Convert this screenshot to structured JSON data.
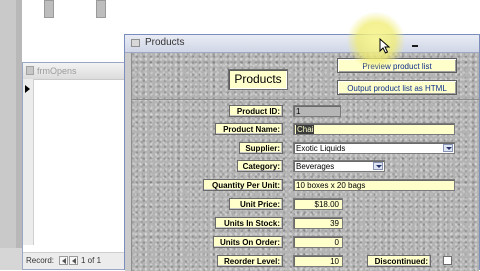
{
  "back_form": {
    "title": "frmOpens",
    "nav_label": "Record:",
    "nav_count": "1 of 1"
  },
  "window": {
    "title": "Products"
  },
  "form": {
    "header_title": "Products",
    "preview_button": "Preview product list",
    "output_button": "Output product list as HTML",
    "fields": {
      "product_id": {
        "label": "Product ID:",
        "value": "1"
      },
      "product_name": {
        "label": "Product Name:",
        "value": "Chai"
      },
      "supplier": {
        "label": "Supplier:",
        "value": "Exotic Liquids"
      },
      "category": {
        "label": "Category:",
        "value": "Beverages"
      },
      "quantity_per_unit": {
        "label": "Quantity Per Unit:",
        "value": "10 boxes x 20 bags"
      },
      "unit_price": {
        "label": "Unit Price:",
        "value": "$18.00"
      },
      "units_in_stock": {
        "label": "Units In Stock:",
        "value": "39"
      },
      "units_on_order": {
        "label": "Units On Order:",
        "value": "0"
      },
      "reorder_level": {
        "label": "Reorder Level:",
        "value": "10"
      },
      "discontinued": {
        "label": "Discontinued:"
      }
    }
  },
  "colors": {
    "field_background": "#ffffcc",
    "form_background": "#b3b3b3",
    "titlebar": "#cfd6e6",
    "button_text": "#0a2a88",
    "cursor_highlight": "#f0ec6e"
  },
  "icons": [
    "document-icon",
    "record-selector-arrow-icon",
    "first-record-icon",
    "previous-record-icon",
    "minimize-icon",
    "dropdown-arrow-icon",
    "mouse-pointer-icon"
  ]
}
